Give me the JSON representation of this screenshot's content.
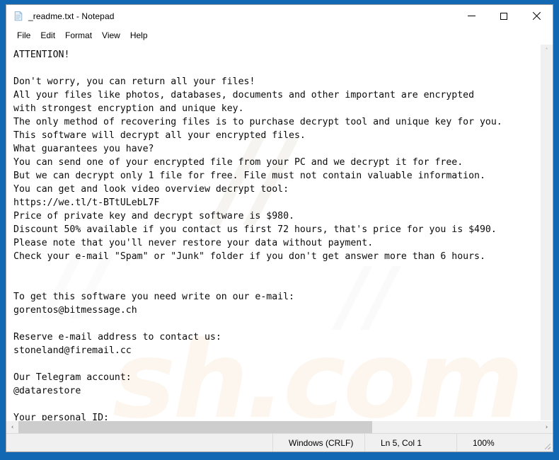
{
  "window": {
    "title": "_readme.txt - Notepad",
    "icon": "notepad-document-icon",
    "controls": {
      "minimize": "Minimize",
      "maximize": "Maximize",
      "close": "Close"
    }
  },
  "menu": {
    "items": [
      {
        "label": "File"
      },
      {
        "label": "Edit"
      },
      {
        "label": "Format"
      },
      {
        "label": "View"
      },
      {
        "label": "Help"
      }
    ]
  },
  "document": {
    "filename": "_readme.txt",
    "content": "ATTENTION!\n\nDon't worry, you can return all your files!\nAll your files like photos, databases, documents and other important are encrypted\nwith strongest encryption and unique key.\nThe only method of recovering files is to purchase decrypt tool and unique key for you.\nThis software will decrypt all your encrypted files.\nWhat guarantees you have?\nYou can send one of your encrypted file from your PC and we decrypt it for free.\nBut we can decrypt only 1 file for free. File must not contain valuable information.\nYou can get and look video overview decrypt tool:\nhttps://we.tl/t-BTtULebL7F\nPrice of private key and decrypt software is $980.\nDiscount 50% available if you contact us first 72 hours, that's price for you is $490.\nPlease note that you'll never restore your data without payment.\nCheck your e-mail \"Spam\" or \"Junk\" folder if you don't get answer more than 6 hours.\n\n\nTo get this software you need write on our e-mail:\ngorentos@bitmessage.ch\n\nReserve e-mail address to contact us:\nstoneland@firemail.cc\n\nOur Telegram account:\n@datarestore\n\nYour personal ID:\n-",
    "lines": [
      "ATTENTION!",
      "",
      "Don't worry, you can return all your files!",
      "All your files like photos, databases, documents and other important are encrypted",
      "with strongest encryption and unique key.",
      "The only method of recovering files is to purchase decrypt tool and unique key for you.",
      "This software will decrypt all your encrypted files.",
      "What guarantees you have?",
      "You can send one of your encrypted file from your PC and we decrypt it for free.",
      "But we can decrypt only 1 file for free. File must not contain valuable information.",
      "You can get and look video overview decrypt tool:",
      "https://we.tl/t-BTtULebL7F",
      "Price of private key and decrypt software is $980.",
      "Discount 50% available if you contact us first 72 hours, that's price for you is $490.",
      "Please note that you'll never restore your data without payment.",
      "Check your e-mail \"Spam\" or \"Junk\" folder if you don't get answer more than 6 hours.",
      "",
      "",
      "To get this software you need write on our e-mail:",
      "gorentos@bitmessage.ch",
      "",
      "Reserve e-mail address to contact us:",
      "stoneland@firemail.cc",
      "",
      "Our Telegram account:",
      "@datarestore",
      "",
      "Your personal ID:",
      "-"
    ],
    "ransom_details": {
      "price_full": "$980",
      "price_discounted": "$490",
      "discount_percent": "50%",
      "discount_window": "72 hours",
      "response_time": "6 hours",
      "video_url": "https://we.tl/t-BTtULebL7F",
      "email_primary": "gorentos@bitmessage.ch",
      "email_reserve": "stoneland@firemail.cc",
      "telegram": "@datarestore",
      "personal_id": "-"
    }
  },
  "scrollbars": {
    "vertical": {
      "up_arrow": "˄",
      "down_arrow": "˅"
    },
    "horizontal": {
      "left_arrow": "‹",
      "right_arrow": "›"
    }
  },
  "statusbar": {
    "line_ending": "Windows (CRLF)",
    "cursor_position": "Ln 5, Col 1",
    "zoom": "100%"
  },
  "watermark": {
    "fragment_1": "//",
    "fragment_2": "sh.com",
    "fragment_3": "//",
    "fragment_4": "//"
  },
  "colors": {
    "desktop": "#1268b3",
    "window_bg": "#ffffff",
    "text": "#0b0b0b",
    "chrome": "#f0f0f0",
    "scroll_thumb": "#cdcdcd"
  }
}
